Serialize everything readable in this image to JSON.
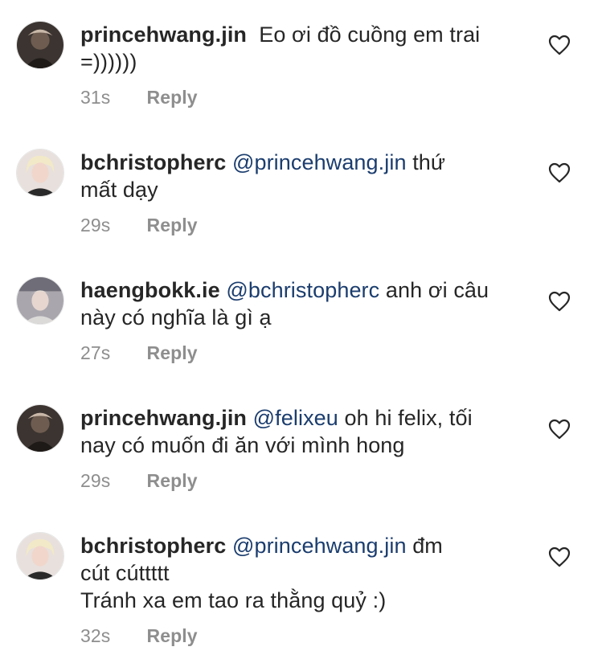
{
  "comments": [
    {
      "username": "princehwang.jin",
      "avatar": "dark-portrait-avatar",
      "mention": "",
      "lines": [
        "Eo ơi đồ cuồng em trai",
        "=))))))"
      ],
      "time": "31s",
      "reply_label": "Reply",
      "like_icon": "heart-outline-icon"
    },
    {
      "username": "bchristopherc",
      "avatar": "blonde-portrait-avatar",
      "mention": "@princehwang.jin",
      "lines": [
        "thứ",
        "mất dạy"
      ],
      "time": "29s",
      "reply_label": "Reply",
      "like_icon": "heart-outline-icon"
    },
    {
      "username": "haengbokk.ie",
      "avatar": "grey-portrait-avatar",
      "mention": "@bchristopherc",
      "lines": [
        "anh ơi câu",
        "này có nghĩa là gì ạ"
      ],
      "time": "27s",
      "reply_label": "Reply",
      "like_icon": "heart-outline-icon"
    },
    {
      "username": "princehwang.jin",
      "avatar": "dark-portrait-avatar",
      "mention": "@felixeu",
      "lines": [
        "oh hi felix, tối",
        "nay có muốn đi ăn với mình hong"
      ],
      "time": "29s",
      "reply_label": "Reply",
      "like_icon": "heart-outline-icon"
    },
    {
      "username": "bchristopherc",
      "avatar": "blonde-portrait-avatar",
      "mention": "@princehwang.jin",
      "lines": [
        "đm",
        "cút cúttttt",
        "Tránh xa em tao ra thằng quỷ :)"
      ],
      "time": "32s",
      "reply_label": "Reply",
      "like_icon": "heart-outline-icon"
    }
  ],
  "colors": {
    "text": "#262626",
    "mention": "#1b3d6e",
    "meta": "#8e8e8e",
    "heart_stroke": "#262626"
  }
}
